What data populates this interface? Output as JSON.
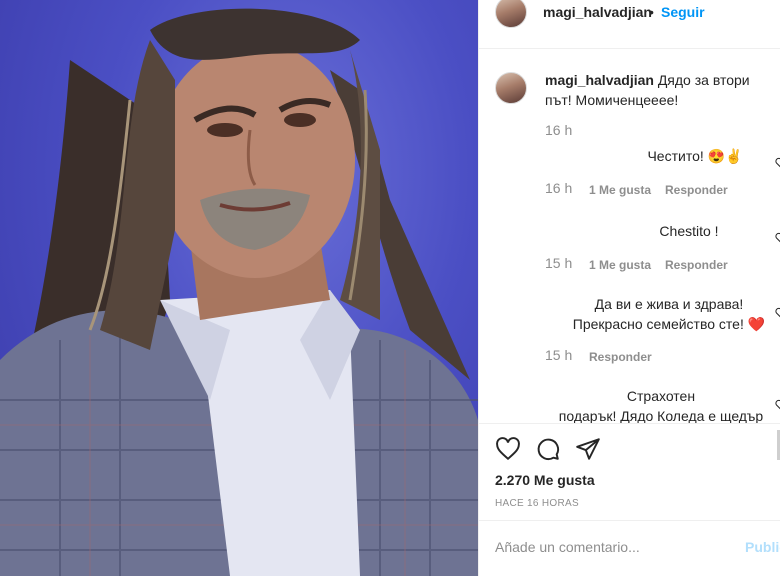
{
  "header": {
    "username": "magi_halvadjian",
    "separator": "•",
    "follow_label": "Seguir"
  },
  "caption": {
    "username": "magi_halvadjian",
    "text": "Дядо за втори път! Момиченцеееe!",
    "time": "16 h"
  },
  "comments": [
    {
      "text": "Честито! 😍✌",
      "time": "16 h",
      "likes": "1 Me gusta",
      "reply": "Responder"
    },
    {
      "text": "Chestito !",
      "time": "15 h",
      "likes": "1 Me gusta",
      "reply": "Responder"
    },
    {
      "text_line1": "Да ви е жива и здрава!",
      "text_line2": "Прекрасно семейство сте! ❤️",
      "time": "15 h",
      "reply": "Responder"
    },
    {
      "text_line1": "Страхотен",
      "text_line2": "подарък! Дядо Коледа е щедър"
    }
  ],
  "actions": {
    "icons": [
      "heart-icon",
      "comment-icon",
      "share-icon"
    ],
    "likes_count": "2.270 Me gusta",
    "posted_ago": "HACE 16 HORAS"
  },
  "add_comment": {
    "placeholder": "Añade un comentario...",
    "publish_label": "Publicar"
  },
  "colors": {
    "accent": "#0095f6",
    "text": "#262626",
    "muted": "#8e8e8e",
    "photo_bg": "#4b4fc4"
  }
}
